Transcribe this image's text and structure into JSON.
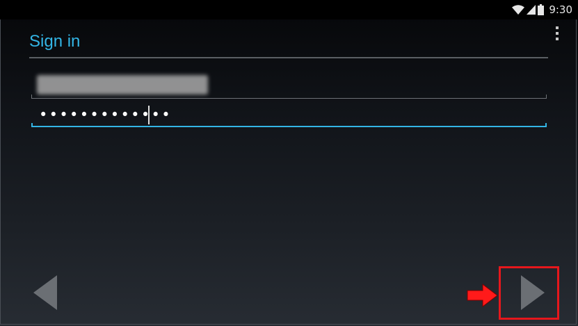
{
  "status_bar": {
    "time": "9:30",
    "icons": [
      "wifi-icon",
      "cell-signal-icon",
      "battery-icon"
    ]
  },
  "header": {
    "title": "Sign in",
    "menu_icon": "overflow-menu-icon"
  },
  "form": {
    "email": {
      "value": "",
      "redacted": true
    },
    "password": {
      "masked_value": "•••••••••••••"
    }
  },
  "navigation": {
    "back_icon": "back-arrow-icon",
    "next_icon": "next-arrow-icon"
  },
  "annotation": {
    "highlight_color": "#e6171c",
    "arrow_icon": "red-pointer-arrow-icon"
  },
  "colors": {
    "accent": "#33b5e5",
    "nav_arrow": "#6b6f74"
  }
}
